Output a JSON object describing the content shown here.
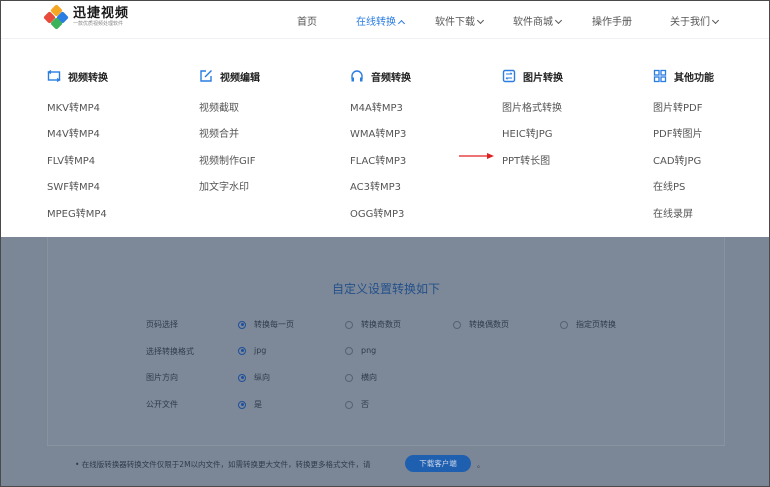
{
  "header": {
    "logo": {
      "title": "迅捷视频",
      "subtitle": "一款优质视频处理软件"
    },
    "nav": [
      {
        "label": "首页",
        "active": false,
        "caret": ""
      },
      {
        "label": "在线转换",
        "active": true,
        "caret": "chevron-up-icon"
      },
      {
        "label": "软件下载",
        "active": false,
        "caret": "chevron-down-icon"
      },
      {
        "label": "软件商城",
        "active": false,
        "caret": "chevron-down-icon"
      },
      {
        "label": "操作手册",
        "active": false,
        "caret": ""
      },
      {
        "label": "关于我们",
        "active": false,
        "caret": "chevron-down-icon"
      }
    ]
  },
  "mega_menu": {
    "columns": [
      {
        "title": "视频转换",
        "icon": "video-convert-icon",
        "items": [
          "MKV转MP4",
          "M4V转MP4",
          "FLV转MP4",
          "SWF转MP4",
          "MPEG转MP4"
        ]
      },
      {
        "title": "视频编辑",
        "icon": "edit-icon",
        "items": [
          "视频截取",
          "视频合并",
          "视频制作GIF",
          "加文字水印"
        ]
      },
      {
        "title": "音频转换",
        "icon": "headphones-icon",
        "items": [
          "M4A转MP3",
          "WMA转MP3",
          "FLAC转MP3",
          "AC3转MP3",
          "OGG转MP3"
        ]
      },
      {
        "title": "图片转换",
        "icon": "image-convert-icon",
        "items": [
          "图片格式转换",
          "HEIC转JPG",
          "PPT转长图"
        ]
      },
      {
        "title": "其他功能",
        "icon": "grid-icon",
        "items": [
          "图片转PDF",
          "PDF转图片",
          "CAD转JPG",
          "在线PS",
          "在线录屏"
        ]
      }
    ],
    "arrow_color": "#e02020"
  },
  "settings": {
    "title": "自定义设置转换如下",
    "rows": [
      {
        "label": "页码选择",
        "options": [
          {
            "label": "转换每一页",
            "selected": true
          },
          {
            "label": "转换奇数页",
            "selected": false
          },
          {
            "label": "转换偶数页",
            "selected": false
          },
          {
            "label": "指定页转换",
            "selected": false
          }
        ]
      },
      {
        "label": "选择转换格式",
        "options": [
          {
            "label": "jpg",
            "selected": true
          },
          {
            "label": "png",
            "selected": false
          }
        ]
      },
      {
        "label": "图片方向",
        "options": [
          {
            "label": "纵向",
            "selected": true
          },
          {
            "label": "横向",
            "selected": false
          }
        ]
      },
      {
        "label": "公开文件",
        "options": [
          {
            "label": "是",
            "selected": true
          },
          {
            "label": "否",
            "selected": false
          }
        ]
      }
    ]
  },
  "footer": {
    "notice": "• 在线版转换器转换文件仅限于2M以内文件，如需转换更大文件，转换更多格式文件，请",
    "download_label": "下载客户端",
    "after": "。"
  },
  "colors": {
    "accent": "#2a7de1",
    "overlay": "#7d8998",
    "button": "#1f5fb0"
  }
}
